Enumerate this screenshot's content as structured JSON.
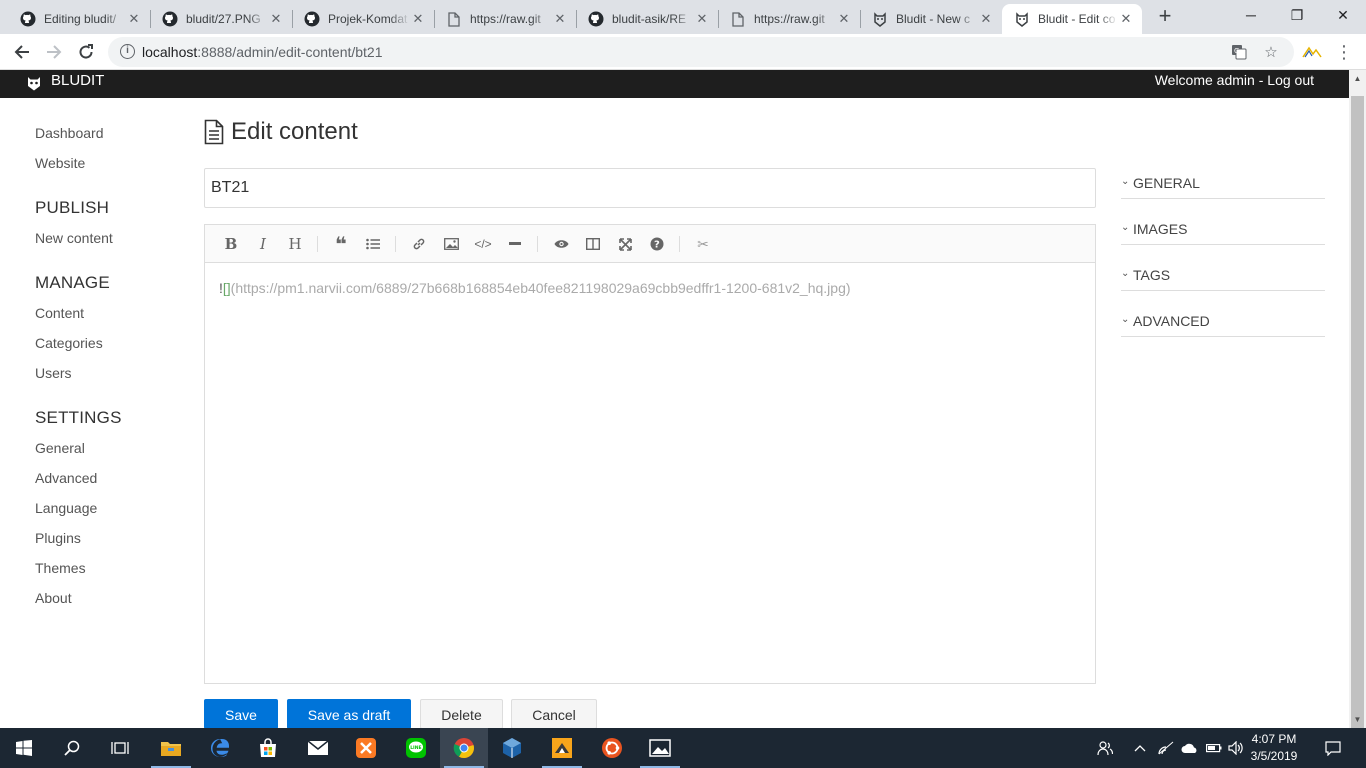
{
  "browser": {
    "tabs": [
      {
        "title": "Editing bludit/",
        "icon": "github-icon"
      },
      {
        "title": "bludit/27.PNG",
        "icon": "github-icon"
      },
      {
        "title": "Projek-Komdat",
        "icon": "github-icon"
      },
      {
        "title": "https://raw.git",
        "icon": "document-icon"
      },
      {
        "title": "bludit-asik/RE",
        "icon": "github-icon"
      },
      {
        "title": "https://raw.git",
        "icon": "document-icon"
      },
      {
        "title": "Bludit - New c",
        "icon": "bludit-icon"
      },
      {
        "title": "Bludit - Edit co",
        "icon": "bludit-icon"
      }
    ],
    "active_tab": 7,
    "url_host": "localhost",
    "url_rest": ":8888/admin/edit-content/bt21"
  },
  "app": {
    "brand": "BLUDIT",
    "welcome": "Welcome admin",
    "separator": " - ",
    "logout": "Log out"
  },
  "sidebar": {
    "dashboard": "Dashboard",
    "website": "Website",
    "publish_heading": "PUBLISH",
    "new_content": "New content",
    "manage_heading": "MANAGE",
    "content": "Content",
    "categories": "Categories",
    "users": "Users",
    "settings_heading": "SETTINGS",
    "general": "General",
    "advanced": "Advanced",
    "language": "Language",
    "plugins": "Plugins",
    "themes": "Themes",
    "about": "About"
  },
  "main": {
    "page_title": "Edit content",
    "title_value": "BT21",
    "editor_bang": "!",
    "editor_brackets": "[]",
    "editor_url": "(https://pm1.narvii.com/6889/27b668b168854eb40fee821198029a69cbb9edffr1-1200-681v2_hq.jpg)"
  },
  "options": {
    "general": "GENERAL",
    "images": "IMAGES",
    "tags": "TAGS",
    "advanced": "ADVANCED"
  },
  "actions": {
    "save": "Save",
    "save_draft": "Save as draft",
    "delete": "Delete",
    "cancel": "Cancel"
  },
  "colors": {
    "primary": "#0074d9",
    "topbar": "#1e1e1e",
    "taskbar": "#1c2733"
  },
  "taskbar": {
    "time": "4:07 PM",
    "date": "3/5/2019"
  }
}
